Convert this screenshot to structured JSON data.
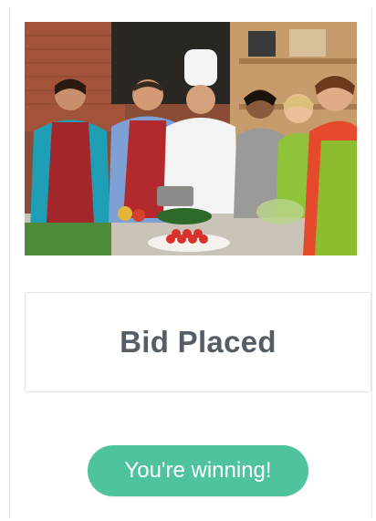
{
  "listing": {
    "image_subject": "cooking-class-photo"
  },
  "bid": {
    "title": "Bid Placed"
  },
  "status": {
    "label": "You're winning!",
    "color": "#4fc29e"
  },
  "colors": {
    "title_text": "#555e66",
    "border": "#e2e4e7"
  }
}
